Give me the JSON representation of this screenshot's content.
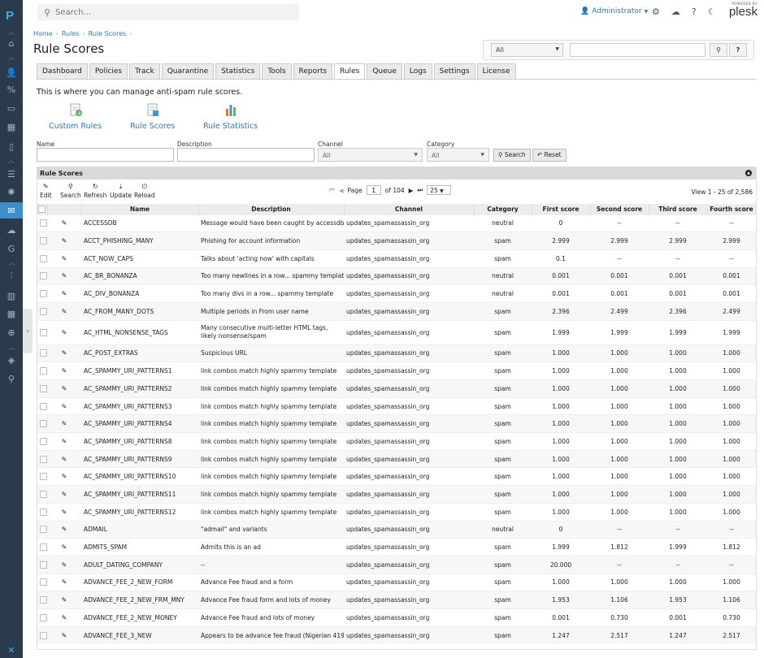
{
  "topbar": {
    "search_placeholder": "Search...",
    "user": "Administrator",
    "brand_top": "POWERED BY",
    "brand": "plesk"
  },
  "breadcrumb": [
    "Home",
    "Rules",
    "Rule Scores"
  ],
  "page_title": "Rule Scores",
  "filter": {
    "select_value": "All"
  },
  "tabs": [
    "Dashboard",
    "Policies",
    "Track",
    "Quarantine",
    "Statistics",
    "Tools",
    "Reports",
    "Rules",
    "Queue",
    "Logs",
    "Settings",
    "License"
  ],
  "active_tab": "Rules",
  "intro": "This is where you can manage anti-spam rule scores.",
  "shortcuts": [
    "Custom Rules",
    "Rule Scores",
    "Rule Statistics"
  ],
  "filters": {
    "name_label": "Name",
    "description_label": "Description",
    "channel_label": "Channel",
    "channel_value": "All",
    "category_label": "Category",
    "category_value": "All",
    "search_btn": "Search",
    "reset_btn": "Reset"
  },
  "grid": {
    "title": "Rule Scores",
    "toolbar": [
      "Edit",
      "Search",
      "Refresh",
      "Update",
      "Reload"
    ],
    "page_label": "Page",
    "page": "1",
    "of_label": "of 104",
    "page_size": "25",
    "view_info": "View 1 - 25 of 2,586",
    "columns": [
      "Name",
      "Description",
      "Channel",
      "Category",
      "First score",
      "Second score",
      "Third score",
      "Fourth score"
    ],
    "rows": [
      [
        "ACCESSDB",
        "Message would have been caught by accessdb",
        "updates_spamassassin_org",
        "neutral",
        "0",
        "--",
        "--",
        "--"
      ],
      [
        "ACCT_PHISHING_MANY",
        "Phishing for account information",
        "updates_spamassassin_org",
        "spam",
        "2.999",
        "2.999",
        "2.999",
        "2.999"
      ],
      [
        "ACT_NOW_CAPS",
        "Talks about 'acting now' with capitals",
        "updates_spamassassin_org",
        "spam",
        "0.1",
        "--",
        "--",
        "--"
      ],
      [
        "AC_BR_BONANZA",
        "Too many newlines in a row... spammy template",
        "updates_spamassassin_org",
        "neutral",
        "0.001",
        "0.001",
        "0.001",
        "0.001"
      ],
      [
        "AC_DIV_BONANZA",
        "Too many divs in a row... spammy template",
        "updates_spamassassin_org",
        "neutral",
        "0.001",
        "0.001",
        "0.001",
        "0.001"
      ],
      [
        "AC_FROM_MANY_DOTS",
        "Multiple periods in From user name",
        "updates_spamassassin_org",
        "spam",
        "2.396",
        "2.499",
        "2.396",
        "2.499"
      ],
      [
        "AC_HTML_NONSENSE_TAGS",
        "Many consecutive multi-letter HTML tags, likely nonsense/spam",
        "updates_spamassassin_org",
        "spam",
        "1.999",
        "1.999",
        "1.999",
        "1.999"
      ],
      [
        "AC_POST_EXTRAS",
        "Suspicious URL",
        "updates_spamassassin_org",
        "spam",
        "1.000",
        "1.000",
        "1.000",
        "1.000"
      ],
      [
        "AC_SPAMMY_URI_PATTERNS1",
        "link combos match highly spammy template",
        "updates_spamassassin_org",
        "spam",
        "1.000",
        "1.000",
        "1.000",
        "1.000"
      ],
      [
        "AC_SPAMMY_URI_PATTERNS2",
        "link combos match highly spammy template",
        "updates_spamassassin_org",
        "spam",
        "1.000",
        "1.000",
        "1.000",
        "1.000"
      ],
      [
        "AC_SPAMMY_URI_PATTERNS3",
        "link combos match highly spammy template",
        "updates_spamassassin_org",
        "spam",
        "1.000",
        "1.000",
        "1.000",
        "1.000"
      ],
      [
        "AC_SPAMMY_URI_PATTERNS4",
        "link combos match highly spammy template",
        "updates_spamassassin_org",
        "spam",
        "1.000",
        "1.000",
        "1.000",
        "1.000"
      ],
      [
        "AC_SPAMMY_URI_PATTERNS8",
        "link combos match highly spammy template",
        "updates_spamassassin_org",
        "spam",
        "1.000",
        "1.000",
        "1.000",
        "1.000"
      ],
      [
        "AC_SPAMMY_URI_PATTERNS9",
        "link combos match highly spammy template",
        "updates_spamassassin_org",
        "spam",
        "1.000",
        "1.000",
        "1.000",
        "1.000"
      ],
      [
        "AC_SPAMMY_URI_PATTERNS10",
        "link combos match highly spammy template",
        "updates_spamassassin_org",
        "spam",
        "1.000",
        "1.000",
        "1.000",
        "1.000"
      ],
      [
        "AC_SPAMMY_URI_PATTERNS11",
        "link combos match highly spammy template",
        "updates_spamassassin_org",
        "spam",
        "1.000",
        "1.000",
        "1.000",
        "1.000"
      ],
      [
        "AC_SPAMMY_URI_PATTERNS12",
        "link combos match highly spammy template",
        "updates_spamassassin_org",
        "spam",
        "1.000",
        "1.000",
        "1.000",
        "1.000"
      ],
      [
        "ADMAIL",
        "\"admail\" and variants",
        "updates_spamassassin_org",
        "neutral",
        "0",
        "--",
        "--",
        "--"
      ],
      [
        "ADMITS_SPAM",
        "Admits this is an ad",
        "updates_spamassassin_org",
        "spam",
        "1.999",
        "1.812",
        "1.999",
        "1.812"
      ],
      [
        "ADULT_DATING_COMPANY",
        "--",
        "updates_spamassassin_org",
        "spam",
        "20.000",
        "--",
        "--",
        "--"
      ],
      [
        "ADVANCE_FEE_2_NEW_FORM",
        "Advance Fee fraud and a form",
        "updates_spamassassin_org",
        "spam",
        "1.000",
        "1.000",
        "1.000",
        "1.000"
      ],
      [
        "ADVANCE_FEE_2_NEW_FRM_MNY",
        "Advance Fee fraud form and lots of money",
        "updates_spamassassin_org",
        "spam",
        "1.953",
        "1.106",
        "1.953",
        "1.106"
      ],
      [
        "ADVANCE_FEE_2_NEW_MONEY",
        "Advance Fee fraud and lots of money",
        "updates_spamassassin_org",
        "spam",
        "0.001",
        "0.730",
        "0.001",
        "0.730"
      ],
      [
        "ADVANCE_FEE_3_NEW",
        "Appears to be advance fee fraud (Nigerian 419)",
        "updates_spamassassin_org",
        "spam",
        "1.247",
        "2.517",
        "1.247",
        "2.517"
      ]
    ]
  },
  "colors": {
    "sidebar": "#2b3b4e",
    "accent": "#2f79b5",
    "active_nav": "#3d8fc7"
  }
}
